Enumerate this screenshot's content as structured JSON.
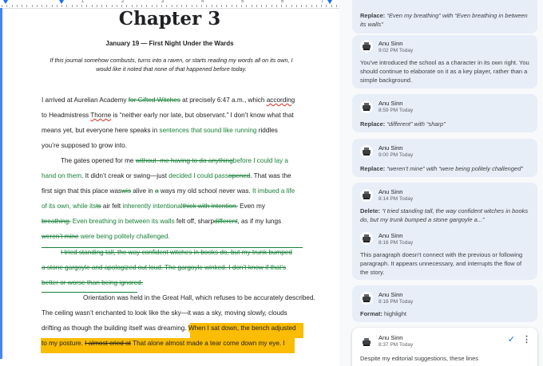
{
  "document": {
    "title": "Chapter 3",
    "subtitle": "January 19 — First Night Under the Wards",
    "intro_line1": "If this journal somehow combusts, turns into a raven, or starts reading my words all on its own, I",
    "intro_line2": "would like it noted that none of that happened before today.",
    "ruler_numbers": [
      "1",
      "2",
      "3",
      "4",
      "5",
      "6",
      "7"
    ],
    "p1": {
      "l1a": "I arrived at Aurelian Academy ",
      "l1b": "for Gifted Witches",
      "l1c": " at precisely 6:47 a.m., which ",
      "l1d": "according",
      "l2a": "to Headmistress ",
      "l2b": "Thorne",
      "l2c": " is “neither early nor late, but observant.” I don’t know what that",
      "l3a": "means yet, but everyone here speaks in ",
      "l3b": "sentences that sound like running",
      "l3c": " riddles",
      "l4": "you’re supposed to grow into."
    },
    "p2": {
      "l1a": "The gates opened for me ",
      "l1b": "without–me having to do anything",
      "l1c": "before I could lay a",
      "l2a": "hand on them",
      "l2b": ". It didn’t creak or swing—just ",
      "l2c": "decided I could pass",
      "l2d": "opened",
      "l2e": ". That was the",
      "l3a": "first sign that this place was",
      "l3b": "wis",
      "l3c": " alive in ",
      "l3d": "a",
      "l3e": " ways my old school never was. ",
      "l3f": "It imbued a life",
      "l4a": "of its own, while its",
      "l4b": "ts",
      "l4c": " air felt ",
      "l4d": "inherently intentional",
      "l4e": "thick with intention.",
      "l4f": " Even my",
      "l5a": "breathing.",
      "l5b": " Even breathing in between its walls",
      "l5c": " felt off, sharp",
      "l5d": "different",
      "l5e": ", as if my lungs",
      "l6a": "weren’t mine",
      "l6b": " were being politely challenged."
    },
    "p3": {
      "l1": "I tried standing tall, the way confident witches in books do, but my trunk bumped",
      "l2": "a stone gargoyle and apologized out loud. The gargoyle winked. I don’t know if that’s",
      "l3": "better or worse than being ignored."
    },
    "p4": {
      "l1": "Orientation was held in the Great Hall, which refuses to be accurately described.",
      "l2": "The ceiling wasn’t enchanted to look like the sky—it was a sky, moving slowly, clouds",
      "l3a": "drifting as though the building itself was dreaming. ",
      "l3b": "When I sat down, the bench adjusted",
      "l4a": "to my posture. ",
      "l4b": "I almost cried at",
      "l4c": " That alone ",
      "l4d": "almost made a tear come down my eye. I"
    }
  },
  "comments": [
    {
      "kind": "suggestion",
      "label": "Replace:",
      "text": "“Even my breathing” with “Even breathing in between its walls”"
    },
    {
      "kind": "comment",
      "author": "Anu Sinn",
      "time": "9:02 PM Today",
      "text": "You've introduced the school as a character in its own right. You should continue to elaborate on it as a key player, rather than a simple background."
    },
    {
      "kind": "suggestion",
      "author": "Anu Sinn",
      "time": "8:59 PM Today",
      "label": "Replace:",
      "text": "“different” with “sharp”"
    },
    {
      "kind": "suggestion",
      "author": "Anu Sinn",
      "time": "9:00 PM Today",
      "label": "Replace:",
      "text": "“weren’t mine” with “were being politely challenged”"
    },
    {
      "kind": "thread",
      "author": "Anu Sinn",
      "time": "8:14 PM Today",
      "label": "Delete:",
      "text": "“I tried standing tall, the way confident witches in books do, but my trunk bumped a stone gargoyle a...”",
      "reply_author": "Anu Sinn",
      "reply_time": "8:16 PM Today",
      "reply_text": "This paragraph doesn't connect with the previous or following paragraph. It appears unnecessary, and interrupts the flow of the story."
    },
    {
      "kind": "format",
      "author": "Anu Sinn",
      "time": "8:18 PM Today",
      "label": "Format:",
      "text": "highlight"
    },
    {
      "kind": "active",
      "author": "Anu Sinn",
      "time": "8:37 PM Today",
      "text": "Despite my editorial suggestions, these lines"
    }
  ],
  "colors": {
    "suggestion_green": "#188038",
    "highlight": "#fbbc04",
    "card_bg": "#e8eef8",
    "accent": "#1a73e8"
  },
  "icons": {
    "resolve": "check-icon",
    "more": "more-vert-icon",
    "avatar": "typewriter-avatar"
  }
}
